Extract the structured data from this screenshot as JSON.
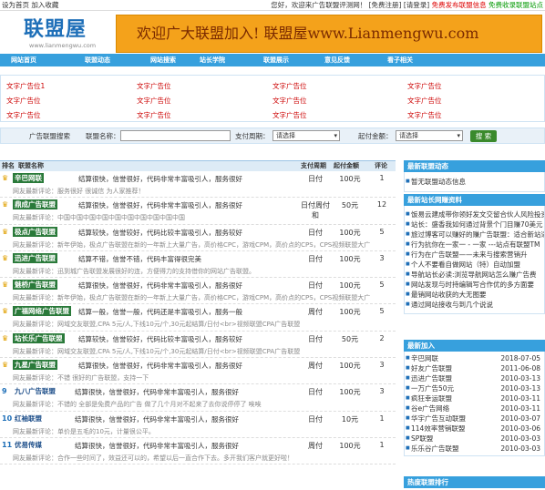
{
  "topbar": {
    "left": "设为首页  加入收藏",
    "welcome": "您好，欢迎来广告联盟评测网！",
    "register": "[免费注册]",
    "login": "[请登录]",
    "notice1": "免费发布联盟信息",
    "notice2": "免费收录联盟站点"
  },
  "header": {
    "logo": "联盟屋",
    "logo_en": "www.lianmengwu.com",
    "banner": "欢迎广大联盟加入!  联盟屋www.Lianmengwu.com"
  },
  "nav": [
    "网站首页",
    "联盟动态",
    "网站搜索",
    "站长学院",
    "联盟展示",
    "意见反馈",
    "看子相关"
  ],
  "ads": [
    "文字广告位1",
    "文字广告位",
    "文字广告位",
    "文字广告位",
    "文字广告位",
    "文字广告位",
    "文字广告位",
    "文字广告位",
    "文字广告位",
    "文字广告位",
    "文字广告位",
    "文字广告位"
  ],
  "search": {
    "title": "广告联盟搜索",
    "name_label": "联盟名称：",
    "cycle_label": "支付周期：",
    "cycle_value": "请选择",
    "amount_label": "起付金额：",
    "amount_value": "请选择",
    "button": "搜 索"
  },
  "list": {
    "headers": [
      "排名",
      "联盟名称",
      "支付周期",
      "起付金额",
      "评论"
    ],
    "rows": [
      {
        "rank": "",
        "name": "辛巴网联",
        "desc": "结算很快，信誉很好，代码非常丰富吸引人，服务很好",
        "review": "网友最新评论：服务很好 很诚信 为人家推荐！",
        "cycle": "日付",
        "amount": "100元",
        "count": "1"
      },
      {
        "rank": "",
        "name": "鼎成广告联盟",
        "desc": "结算很快，信誉很好，代码非常丰富吸引人，服务很好",
        "review": "网友最新评论：中国中国中国中国中国中国中国中国中国中国",
        "cycle": "日付周付和",
        "amount": "50元",
        "count": "12"
      },
      {
        "rank": "",
        "name": "极点广告联盟",
        "desc": "结算较快，信誉较好，代码比较丰富吸引人，服务较好",
        "review": "网友最新评论：新年伊始，极点广告联盟在新的一年新上大量广告，高价格CPC，游戏CPM，高价点的CPS，CPS视频联盟大广",
        "cycle": "日付",
        "amount": "100元",
        "count": "5"
      },
      {
        "rank": "",
        "name": "迅进广告联盟",
        "desc": "结算不错，信誉不错，代码丰富得很完美",
        "review": "网友最新评论：迅到城广告联盟发展很好的连，方便得力的支持借你的网站广告联盟。",
        "cycle": "日付",
        "amount": "100元",
        "count": "3"
      },
      {
        "rank": "",
        "name": "魅桥广告联盟",
        "desc": "结算很快，信誉很好，代码非常丰富吸引人，服务很好",
        "review": "网友最新评论：新年伊始，极点广告联盟在新的一年新上大量广告，高价格CPC，游戏CPM，高价点的CPS，CPS视频联盟大广",
        "cycle": "日付",
        "amount": "100元",
        "count": "5"
      },
      {
        "rank": "",
        "name": "广福网络广告联盟",
        "desc": "结算一般，信誉一般，代码还是丰富吸引人，服务一般",
        "review": "网友最新评论：网域交友联盟,CPA 5元/人,下线10元/个,30元起结算/日付<br>视频联盟CPA广告联盟",
        "cycle": "周付",
        "amount": "100元",
        "count": "5"
      },
      {
        "rank": "",
        "name": "站长乐广告联盟",
        "desc": "结算较快，信誉较好，代码比较丰富吸引人，服务较好",
        "review": "网友最新评论：网域交友联盟,CPA 5元/人,下线10元/个,30元起结算/日付<br>视频联盟CPA广告联盟",
        "cycle": "日付",
        "amount": "50元",
        "count": "2"
      },
      {
        "rank": "",
        "name": "九星广告联盟",
        "desc": "结算很快，信誉很好，代码非常丰富吸引人，服务很好",
        "review": "网友最新评论：不错 很好的广告联盟，支持一下",
        "cycle": "周付",
        "amount": "100元",
        "count": "3"
      },
      {
        "rank": "9",
        "name": "九八广告联盟",
        "desc": "结算很快，信誉很好，代码非常丰富吸引人，服务很好",
        "review": "网友最新评论：不错的 全部是免费产品的广告 做了几个月对不起来了去你说停停了 唉唉",
        "cycle": "日付",
        "amount": "100元",
        "count": "3"
      },
      {
        "rank": "10",
        "name": "红袖联盟",
        "desc": "结算很快，信誉很好，代码非常丰富吸引人，服务很好",
        "review": "网友最新评论：单价是五毛的10元，计量很公平。",
        "cycle": "日付",
        "amount": "10元",
        "count": "1"
      },
      {
        "rank": "11",
        "name": "优易传媒",
        "desc": "结算很快，信誉很好，代码非常丰富吸引人，服务很好",
        "review": "网友最新评论：合作一些时间了，效益还可以的，希望以后一直合作下去。多开我们客户就更好啦！",
        "cycle": "周付",
        "amount": "100元",
        "count": "1"
      }
    ]
  },
  "sidebar": {
    "news_title": "最新联盟动态",
    "news": [
      "暂无联盟动态信息"
    ],
    "articles_title": "最新站长网赚资料",
    "articles": [
      "饭易云建成带你领好发文交留合伙人风险投资",
      "站长：盛香我如何通过背景个门目赚70美元",
      "旅过博客可以赚好的赚广告联盟：适合新站适合",
      "行为抗你在一家一 - 一家 ---站点有联盟TM",
      "    行为在广告联盟——未来与搜索营销升",
      "个人不要看自做网站（特）自动加盟",
      "导航站长必读:浏览导航网站怎么赚广告费",
      "网站发现与时持编辑写合作优的多方面要",
      "最销网站收获的大无图要",
      "通过网站接收与到几个说说"
    ],
    "new_title": "最新加入",
    "new_items": [
      {
        "name": "辛巴网联",
        "date": "2018-07-05"
      },
      {
        "name": "好友广告联盟",
        "date": "2011-06-08"
      },
      {
        "name": "迅进广告联盟",
        "date": "2010-03-13"
      },
      {
        "name": "一万广告50元",
        "date": "2010-03-13"
      },
      {
        "name": "疯狂幸运联盟",
        "date": "2010-03-11"
      },
      {
        "name": "谷e广告网络",
        "date": "2010-03-11"
      },
      {
        "name": "华宇广告互动联盟",
        "date": "2010-03-07"
      },
      {
        "name": "114效率营销联盟",
        "date": "2010-03-06"
      },
      {
        "name": "SP联盟",
        "date": "2010-03-03"
      },
      {
        "name": "乐乐谷广告联盟",
        "date": "2010-03-03"
      }
    ],
    "rank_title": "热度联盟排行"
  }
}
